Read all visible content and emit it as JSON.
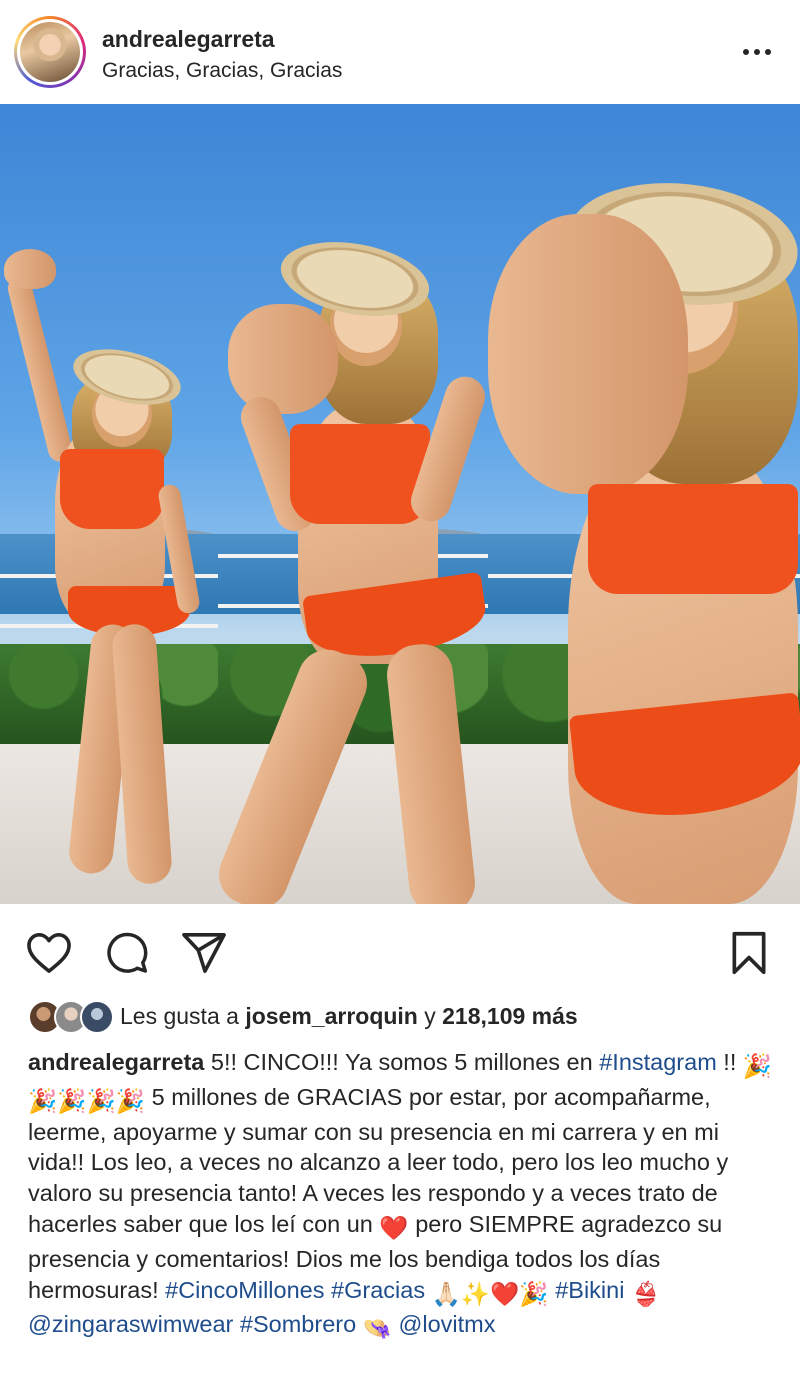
{
  "post": {
    "username": "andrealegarreta",
    "subtitle": "Gracias, Gracias, Gracias"
  },
  "photo": {
    "alt_panels": 3
  },
  "likes": {
    "prefix": "Les gusta a ",
    "user": "josem_arroquin",
    "middle": " y ",
    "count": "218,109 más"
  },
  "caption": {
    "username": "andrealegarreta",
    "t1": " 5!! CINCO!!! Ya somos 5 millones en ",
    "tag_instagram": "#Instagram",
    "t2": " !! ",
    "t3": " 5 millones de GRACIAS por estar, por acompañarme, leerme, apoyarme y sumar con su presencia en mi carrera y en mi vida!! Los leo, a veces no alcanzo a leer todo, pero los leo mucho y valoro su presencia tanto! A veces les respondo y a veces trato de hacerles saber que los leí con un ",
    "t4": " pero SIEMPRE agradezco su presencia y comentarios! Dios me los bendiga todos los días hermosuras! ",
    "tag_cinco": "#CincoMillones",
    "tag_gracias": "#Gracias",
    "tag_bikini": "#Bikini",
    "mention_zingara": "@zingaraswimwear",
    "tag_sombrero": "#Sombrero",
    "mention_lovit": "@lovitmx",
    "emoji_party": "🎉",
    "emoji_pray": "🙏🏻",
    "emoji_sparkles": "✨",
    "emoji_heart": "❤️",
    "emoji_bikini": "👙",
    "emoji_hat": "👒"
  },
  "colors": {
    "link": "#1f4d8c",
    "text": "#262626"
  }
}
